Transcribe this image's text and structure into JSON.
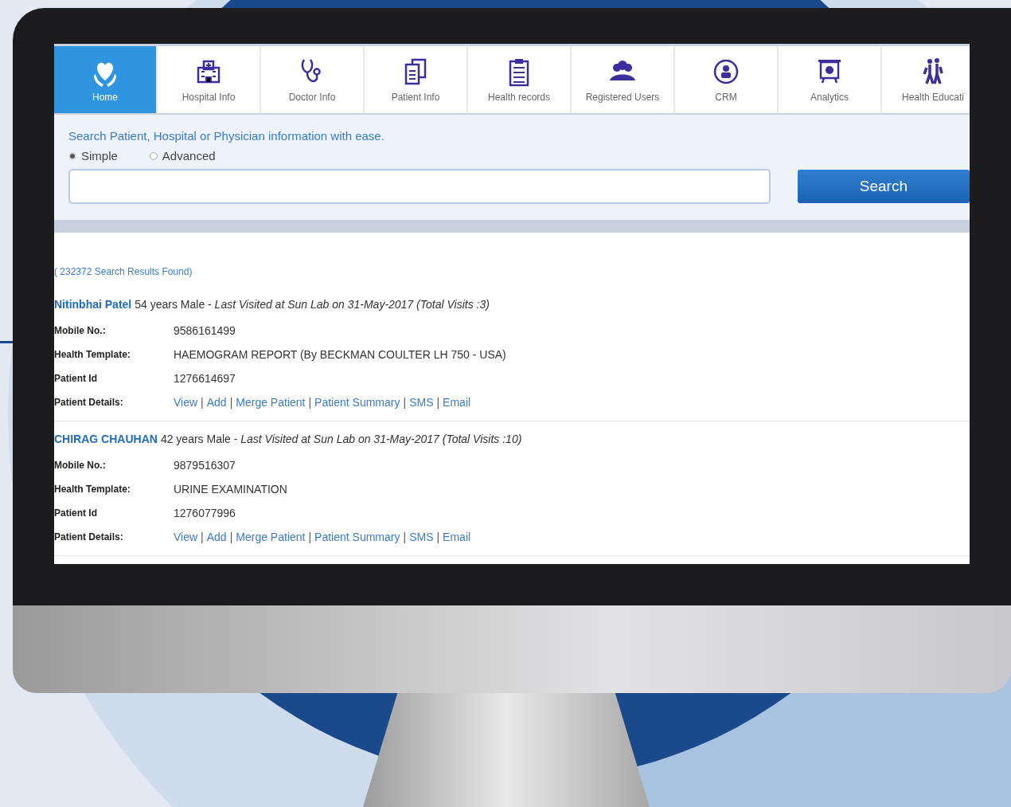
{
  "nav": [
    {
      "label": "Home",
      "selected": true
    },
    {
      "label": "Hospital Info",
      "selected": false
    },
    {
      "label": "Doctor Info",
      "selected": false
    },
    {
      "label": "Patient Info",
      "selected": false
    },
    {
      "label": "Health records",
      "selected": false
    },
    {
      "label": "Registered Users",
      "selected": false
    },
    {
      "label": "CRM",
      "selected": false
    },
    {
      "label": "Analytics",
      "selected": false
    },
    {
      "label": "Health Educati",
      "selected": false
    }
  ],
  "search": {
    "hint": "Search Patient, Hospital or Physician information with ease.",
    "modes": [
      {
        "label": "Simple",
        "selected": true
      },
      {
        "label": "Advanced",
        "selected": false
      }
    ],
    "button": "Search"
  },
  "results_count": "( 232372 Search Results Found)",
  "link_separator": "|",
  "results": [
    {
      "name": "Nitinbhai Patel",
      "summary": "54 years Male - *Last Visited at Sun Lab on 31-May-2017 (Total Visits :3)*",
      "fields": [
        {
          "label": "Mobile No.:",
          "value": "9586161499"
        },
        {
          "label": "Health Template:",
          "value": "HAEMOGRAM REPORT (By BECKMAN COULTER LH 750 - USA)"
        },
        {
          "label": "Patient Id",
          "value": "1276614697"
        }
      ],
      "links_label": "Patient Details:",
      "links": [
        "View",
        "Add",
        "Merge Patient",
        "Patient Summary",
        "SMS",
        "Email"
      ]
    },
    {
      "name": "CHIRAG CHAUHAN",
      "summary": "42 years Male - *Last Visited at Sun Lab on 31-May-2017 (Total Visits :10)*",
      "fields": [
        {
          "label": "Mobile No.:",
          "value": "9879516307"
        },
        {
          "label": "Health Template:",
          "value": "URINE EXAMINATION"
        },
        {
          "label": "Patient Id",
          "value": "1276077996"
        }
      ],
      "links_label": "Patient Details:",
      "links": [
        "View",
        "Add",
        "Merge Patient",
        "Patient Summary",
        "SMS",
        "Email"
      ]
    }
  ]
}
